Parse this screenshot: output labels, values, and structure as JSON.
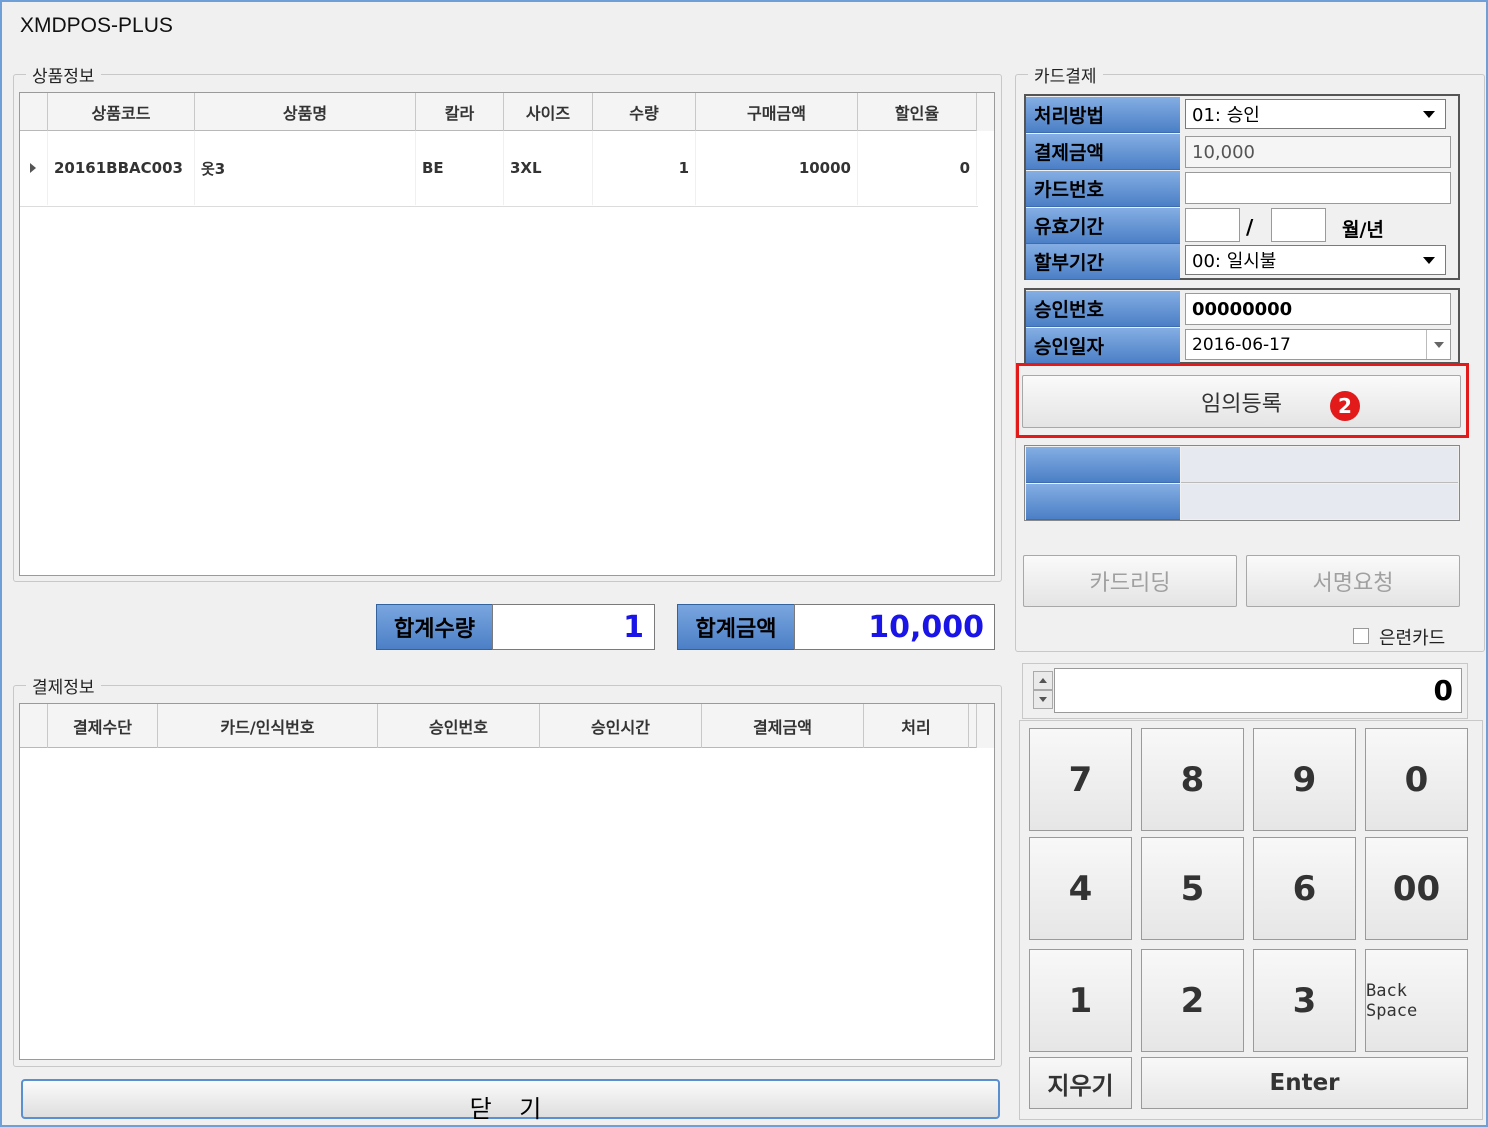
{
  "window": {
    "title": "XMDPOS-PLUS"
  },
  "product_section": {
    "title": "상품정보",
    "columns": [
      "상품코드",
      "상품명",
      "칼라",
      "사이즈",
      "수량",
      "구매금액",
      "할인율"
    ],
    "rows": [
      {
        "code": "20161BBAC003",
        "name": "옷3",
        "color": "BE",
        "size": "3XL",
        "qty": "1",
        "amount": "10000",
        "discount": "0"
      }
    ]
  },
  "totals": {
    "qty_label": "합계수량",
    "qty_value": "1",
    "amount_label": "합계금액",
    "amount_value": "10,000"
  },
  "payment_section": {
    "title": "결제정보",
    "columns": [
      "결제수단",
      "카드/인식번호",
      "승인번호",
      "승인시간",
      "결제금액",
      "처리"
    ]
  },
  "close_button": "닫 기",
  "card_payment": {
    "title": "카드결제",
    "method_label": "처리방법",
    "method_value": "01: 승인",
    "amount_label": "결제금액",
    "amount_value": "10,000",
    "card_no_label": "카드번호",
    "card_no_value": "",
    "expiry_label": "유효기간",
    "expiry_sep": "/",
    "expiry_unit": "월/년",
    "installment_label": "할부기간",
    "installment_value": "00: 일시불",
    "approval_no_label": "승인번호",
    "approval_no_value": "00000000",
    "approval_date_label": "승인일자",
    "approval_date_value": "2016-06-17",
    "manual_register_button": "임의등록",
    "annotation_number": "2",
    "card_reading_button": "카드리딩",
    "sign_request_button": "서명요청",
    "hidden_card_label": "은련카드"
  },
  "keypad": {
    "display_value": "0",
    "keys": [
      "7",
      "8",
      "9",
      "0",
      "4",
      "5",
      "6",
      "00",
      "1",
      "2",
      "3",
      "Back Space"
    ],
    "clear_label": "지우기",
    "enter_label": "Enter"
  },
  "colors": {
    "accent_blue": "#4b7fc6",
    "total_value": "#1a14e6",
    "highlight": "#e21a1a"
  }
}
